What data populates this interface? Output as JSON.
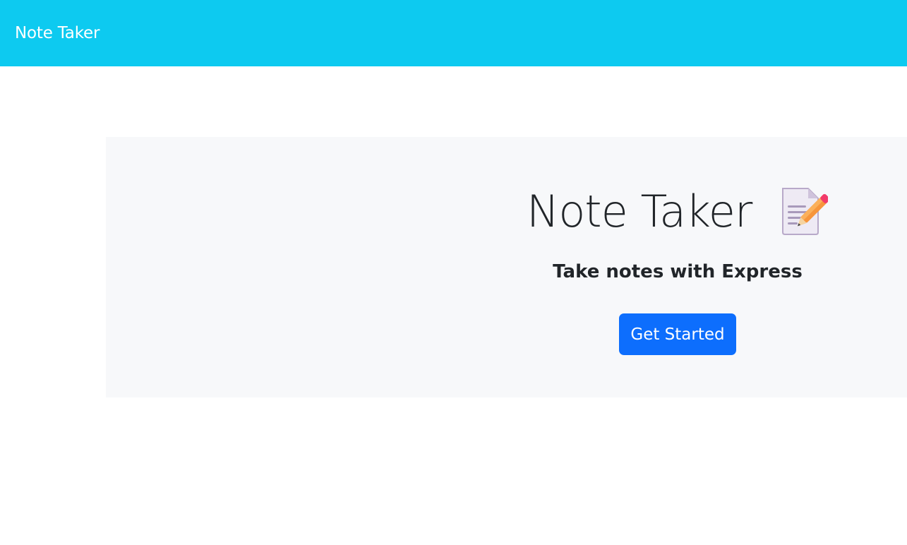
{
  "navbar": {
    "brand": "Note Taker",
    "background_color": "#0dcaf0"
  },
  "hero": {
    "title": "Note Taker",
    "title_icon": "memo-icon",
    "subtitle": "Take notes with Express",
    "button_label": "Get Started",
    "button_color": "#0d6efd",
    "background_color": "#f7f8fa"
  }
}
